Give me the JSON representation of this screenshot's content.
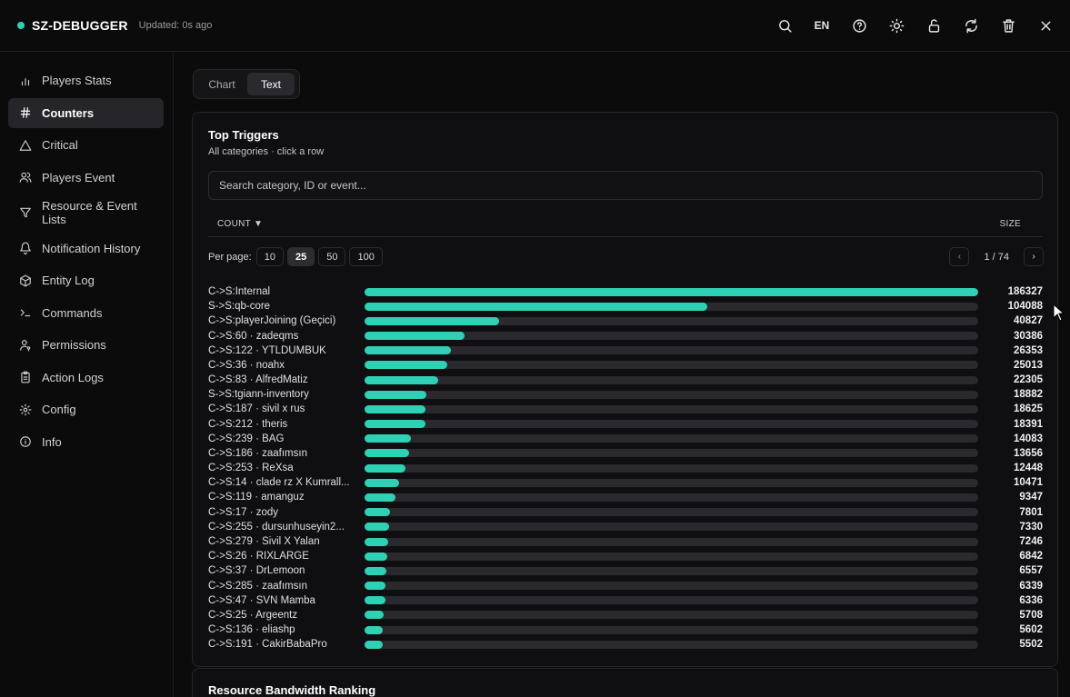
{
  "app": {
    "name": "SZ-DEBUGGER",
    "updated": "Updated: 0s ago",
    "language": "EN",
    "status_color": "#2fd1b4"
  },
  "toolbar_icons": [
    "search-icon",
    "help-icon",
    "sun-icon",
    "unlock-icon",
    "refresh-icon",
    "trash-icon",
    "close-icon"
  ],
  "sidebar": {
    "items": [
      {
        "label": "Players Stats",
        "icon": "bar-chart-icon"
      },
      {
        "label": "Counters",
        "icon": "hash-icon",
        "active": true
      },
      {
        "label": "Critical",
        "icon": "alert-triangle-icon"
      },
      {
        "label": "Players Event",
        "icon": "users-icon"
      },
      {
        "label": "Resource & Event Lists",
        "icon": "filter-icon"
      },
      {
        "label": "Notification History",
        "icon": "bell-icon"
      },
      {
        "label": "Entity Log",
        "icon": "box-icon"
      },
      {
        "label": "Commands",
        "icon": "terminal-icon"
      },
      {
        "label": "Permissions",
        "icon": "user-key-icon"
      },
      {
        "label": "Action Logs",
        "icon": "clipboard-icon"
      },
      {
        "label": "Config",
        "icon": "gear-icon"
      },
      {
        "label": "Info",
        "icon": "info-icon"
      }
    ]
  },
  "view_toggle": {
    "chart": "Chart",
    "text": "Text",
    "selected": "Text"
  },
  "triggers": {
    "title": "Top Triggers",
    "subtitle": "All categories · click a row",
    "search_placeholder": "Search category, ID or event...",
    "col_count": "COUNT ▼",
    "col_size": "SIZE",
    "per_page_label": "Per page:",
    "per_page_options": [
      "10",
      "25",
      "50",
      "100"
    ],
    "per_page_selected": "25",
    "prev": "‹",
    "next": "›",
    "page_text": "1 / 74",
    "bar_color": "#2fd1b4",
    "max_value": 186327
  },
  "chart_data": {
    "type": "bar",
    "categories": [
      "C->S:Internal",
      "S->S:qb-core",
      "C->S:playerJoining (Geçici)",
      "C->S:60 · zadeqms",
      "C->S:122 · YTLDÜMBÜK",
      "C->S:36 · noahx",
      "C->S:83 · AlfredMatiz",
      "S->S:tgiann-inventory",
      "C->S:187 · sivil x rus",
      "C->S:212 · theris",
      "C->S:239 · BAG",
      "C->S:186 · zaafımsın",
      "C->S:253 · ReXsa",
      "C->S:14 · clade rz X Kumrall...",
      "C->S:119 · amanguz",
      "C->S:17 · zody",
      "C->S:255 · dursunhuseyin2...",
      "C->S:279 · Sivil X Yalan",
      "C->S:26 · RIXLARGE",
      "C->S:37 · DrLemoon",
      "C->S:285 · zaafımsın",
      "C->S:47 · SVN Mamba",
      "C->S:25 · Argeentz",
      "C->S:136 · eliashp",
      "C->S:191 · CakirBabaPro"
    ],
    "values": [
      186327,
      104088,
      40827,
      30386,
      26353,
      25013,
      22305,
      18882,
      18625,
      18391,
      14083,
      13656,
      12448,
      10471,
      9347,
      7801,
      7330,
      7246,
      6842,
      6557,
      6339,
      6336,
      5708,
      5602,
      5502
    ]
  },
  "bandwidth": {
    "title": "Resource Bandwidth Ranking"
  }
}
